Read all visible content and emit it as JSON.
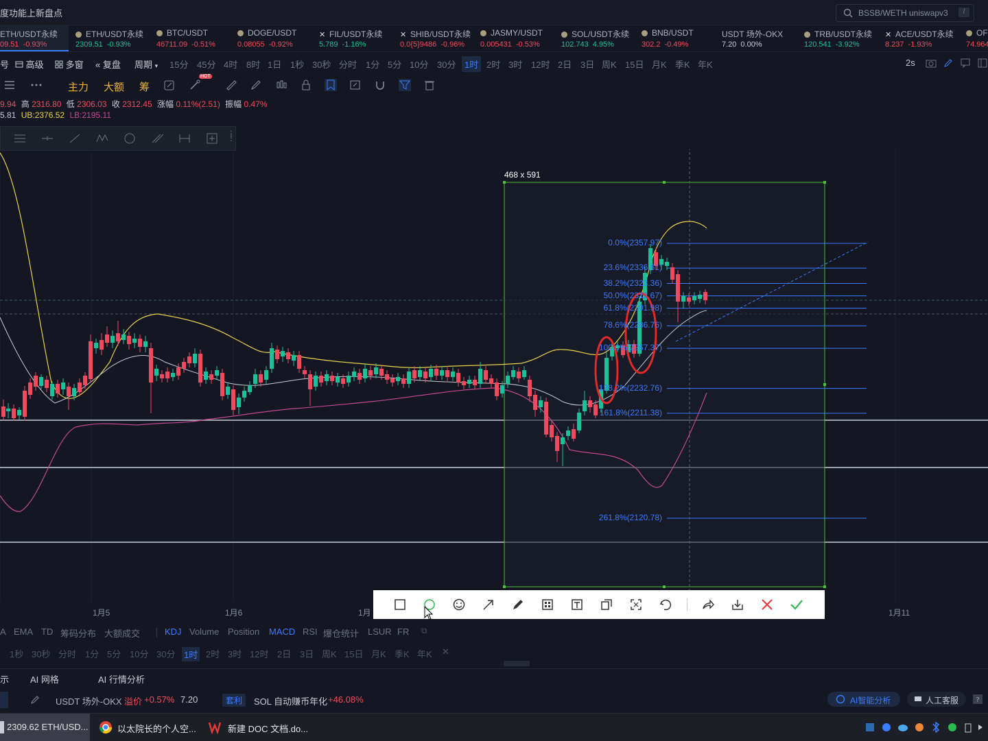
{
  "header": {
    "announcement": "度功能上新盘点",
    "search_placeholder": "BSSB/WETH uniswapv3",
    "search_shortcut": "/"
  },
  "tickers": [
    {
      "name": "ETH/USDT永续",
      "price": "09.51",
      "change": "-0.93%",
      "dir": "dn",
      "active": true
    },
    {
      "name": "ETH/USDT永续",
      "price": "2309.51",
      "change": "-0.93%",
      "dir": "up"
    },
    {
      "name": "BTC/USDT",
      "price": "46711.09",
      "change": "-0.51%",
      "dir": "dn"
    },
    {
      "name": "DOGE/USDT",
      "price": "0.08055",
      "change": "-0.92%",
      "dir": "dn"
    },
    {
      "name": "FIL/USDT永续",
      "price": "5.789",
      "change": "-1.16%",
      "dir": "up"
    },
    {
      "name": "SHIB/USDT永续",
      "price": "0.0{5}9486",
      "change": "-0.96%",
      "dir": "dn"
    },
    {
      "name": "JASMY/USDT",
      "price": "0.005431",
      "change": "-0.53%",
      "dir": "dn"
    },
    {
      "name": "SOL/USDT永续",
      "price": "102.743",
      "change": "4.95%",
      "dir": "up"
    },
    {
      "name": "BNB/USDT",
      "price": "302.2",
      "change": "-0.49%",
      "dir": "dn"
    },
    {
      "name": "USDT 场外-OKX",
      "price": "7.20",
      "change": "0.00%",
      "dir": "neutral"
    },
    {
      "name": "TRB/USDT永续",
      "price": "120.541",
      "change": "-3.92%",
      "dir": "up"
    },
    {
      "name": "ACE/USDT永续",
      "price": "8.237",
      "change": "-1.93%",
      "dir": "dn"
    },
    {
      "name": "OF",
      "price": "74.964",
      "change": "",
      "dir": "dn"
    }
  ],
  "period_bar": {
    "left_items": [
      "号",
      "高级",
      "多窗",
      "复盘",
      "周期"
    ],
    "periods": [
      "15分",
      "45分",
      "4时",
      "8时",
      "1日",
      "1秒",
      "30秒",
      "分时",
      "1分",
      "5分",
      "10分",
      "30分",
      "1时",
      "2时",
      "3时",
      "12时",
      "2日",
      "3日",
      "周K",
      "15日",
      "月K",
      "季K",
      "年K"
    ],
    "active_period": "1时",
    "refresh": "2s"
  },
  "toolbar": {
    "labels": [
      "主力",
      "大额",
      "筹"
    ],
    "hot_badge": "HOT"
  },
  "ohlc": {
    "open_frag": "9.94",
    "high_label": "高",
    "high": "2316.80",
    "low_label": "低",
    "low": "2306.03",
    "close_label": "收",
    "close": "2312.45",
    "chg_label": "涨幅",
    "chg": "0.11%(2.51)",
    "amp_label": "振幅",
    "amp": "0.47%",
    "boll_frag": "5.81",
    "ub": "UB:2376.52",
    "lb": "LB:2195.11"
  },
  "selection": {
    "size_label": "468 x 591"
  },
  "fib_levels": [
    {
      "label": "0.0%(2357.97)",
      "value": 2357.97
    },
    {
      "label": "23.6%(2336.61)",
      "value": 2336.61
    },
    {
      "label": "38.2%(2323.36)",
      "value": 2323.36
    },
    {
      "label": "50.0%(2312.67)",
      "value": 2312.67
    },
    {
      "label": "61.8%(2301.98)",
      "value": 2301.98
    },
    {
      "label": "78.6%(2286.76)",
      "value": 2286.76
    },
    {
      "label": "100.0%(2267.37)",
      "value": 2267.37
    },
    {
      "label": "138.2%(2232.76)",
      "value": 2232.76
    },
    {
      "label": "161.8%(2211.38)",
      "value": 2211.38
    },
    {
      "label": "261.8%(2120.78)",
      "value": 2120.78
    }
  ],
  "x_axis": {
    "labels": [
      "1月5",
      "1月6",
      "1月",
      "1月11"
    ]
  },
  "indicators": {
    "items": [
      "A",
      "EMA",
      "TD",
      "筹码分布",
      "大额成交",
      "KDJ",
      "Volume",
      "Position",
      "MACD",
      "RSI",
      "爆仓统计",
      "LSUR",
      "FR"
    ],
    "active": [
      "KDJ",
      "MACD"
    ]
  },
  "indicator_periods": {
    "items": [
      "1秒",
      "30秒",
      "分时",
      "1分",
      "5分",
      "10分",
      "30分",
      "1时",
      "2时",
      "3时",
      "12时",
      "2日",
      "3日",
      "周K",
      "15日",
      "月K",
      "季K",
      "年K"
    ],
    "active": "1时"
  },
  "ai_tabs": [
    "示",
    "AI 网格",
    "AI 行情分析"
  ],
  "status": {
    "otc_label": "USDT 场外-OKX",
    "premium_label": "溢价",
    "premium": "+0.57%",
    "otc_price": "7.20",
    "arb_badge": "套利",
    "sol_text": "SOL 自动赚币年化",
    "sol_rate": "+46.08%",
    "ai_button": "AI智能分析",
    "service_button": "人工客服"
  },
  "taskbar": {
    "items": [
      "2309.62 ETH/USD...",
      "以太院长的个人空...",
      "新建 DOC 文档.do..."
    ]
  },
  "colors": {
    "up": "#17c39a",
    "down": "#f2495e",
    "accent": "#3b7bff",
    "gold": "#e8b33a"
  }
}
